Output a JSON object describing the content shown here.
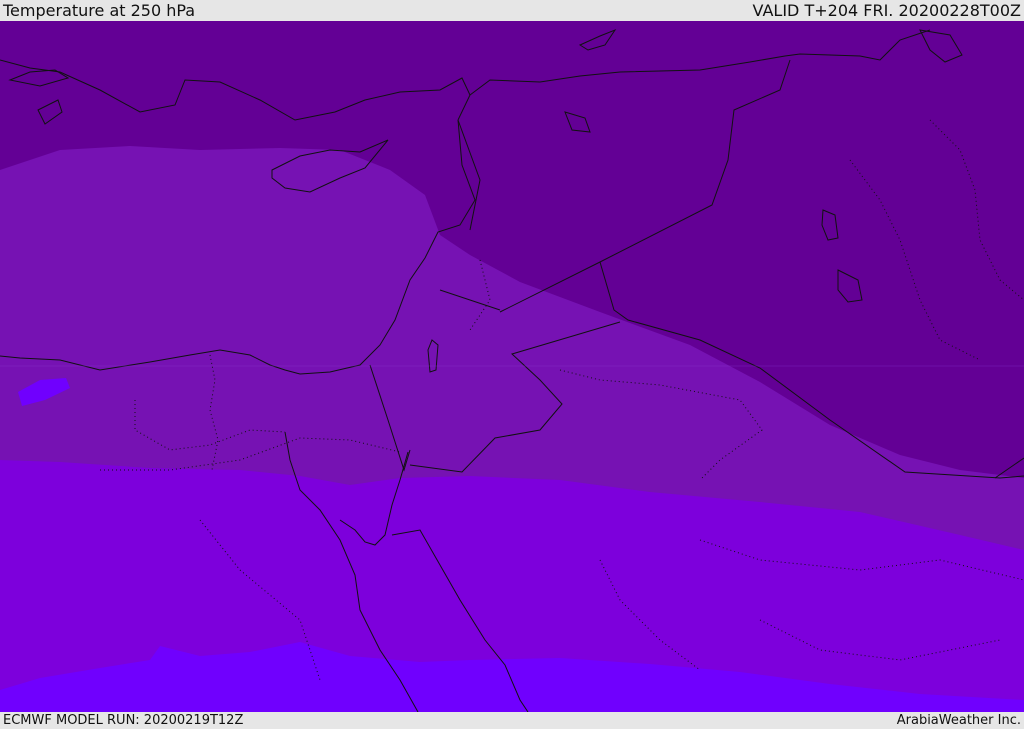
{
  "header": {
    "title": "Temperature at 250 hPa",
    "valid": "VALID T+204 FRI. 20200228T00Z"
  },
  "footer": {
    "model_run": "ECMWF MODEL RUN: 20200219T12Z",
    "credit": "ArabiaWeather Inc."
  },
  "bands": [
    {
      "name": "band-coldest",
      "color": "#630095"
    },
    {
      "name": "band-cold",
      "color": "#7612b3"
    },
    {
      "name": "band-mid",
      "color": "#7d00dc"
    },
    {
      "name": "band-warm",
      "color": "#7000fe"
    }
  ],
  "coastline_color": "#111111"
}
